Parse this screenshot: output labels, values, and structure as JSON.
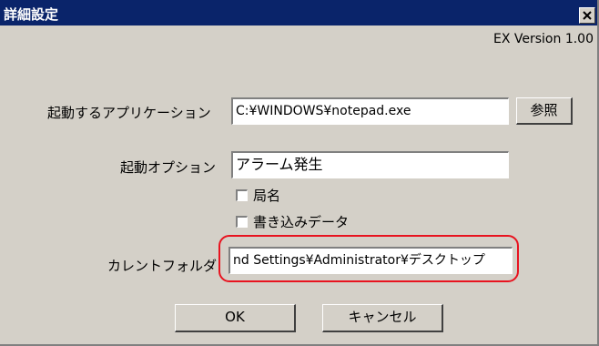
{
  "window": {
    "title": "詳細設定"
  },
  "version_text": "EX Version 1.00",
  "app": {
    "label": "起動するアプリケーション",
    "value": "C:¥WINDOWS¥notepad.exe",
    "browse_label": "参照"
  },
  "option": {
    "label": "起動オプション",
    "value": "アラーム発生"
  },
  "checkboxes": [
    {
      "label": "局名",
      "checked": false
    },
    {
      "label": "書き込みデータ",
      "checked": false
    }
  ],
  "folder": {
    "label": "カレントフォルダ",
    "value": "nd Settings¥Administrator¥デスクトップ"
  },
  "buttons": {
    "ok": "OK",
    "cancel": "キャンセル"
  },
  "colors": {
    "titlebar": "#0a246a",
    "face": "#d4d0c8",
    "highlight": "#e8131f"
  }
}
